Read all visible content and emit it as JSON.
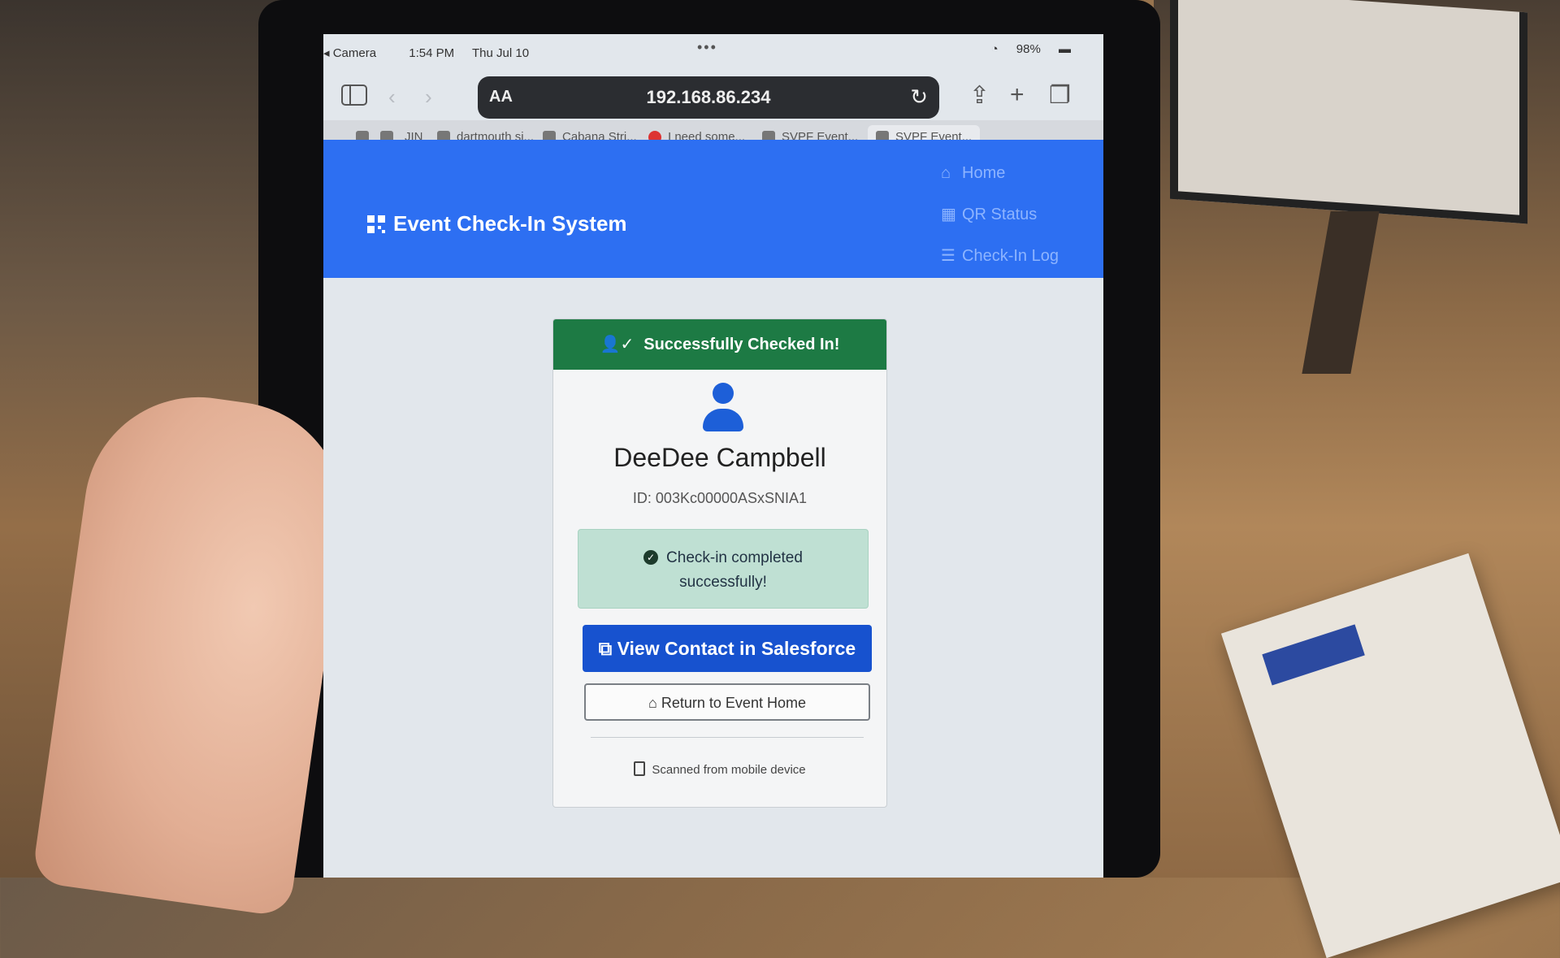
{
  "status_bar": {
    "back_app": "Camera",
    "time": "1:54 PM",
    "date": "Thu Jul 10",
    "battery": "98%"
  },
  "toolbar": {
    "text_size_label": "AA",
    "url": "192.168.86.234"
  },
  "tabs": [
    {
      "label": "JIN"
    },
    {
      "label": "dartmouth si..."
    },
    {
      "label": "Cabana Stri..."
    },
    {
      "label": "I need some..."
    },
    {
      "label": "SVPF Event..."
    },
    {
      "label": "SVPF Event..."
    }
  ],
  "app": {
    "brand": "Event Check-In System",
    "nav": [
      {
        "label": "Home",
        "icon": "home-icon"
      },
      {
        "label": "QR Status",
        "icon": "qr-icon"
      },
      {
        "label": "Check-In Log",
        "icon": "list-icon"
      }
    ],
    "accent_color": "#2d6ff2"
  },
  "card": {
    "header": "Successfully Checked In!",
    "header_color": "#1d7a44",
    "name": "DeeDee Campbell",
    "id": "ID: 003Kc00000ASxSNIA1",
    "alert_line1": "Check-in completed",
    "alert_line2": "successfully!",
    "primary_button": "View Contact in Salesforce",
    "secondary_button": "Return to Event Home",
    "footer": "Scanned from mobile device"
  }
}
